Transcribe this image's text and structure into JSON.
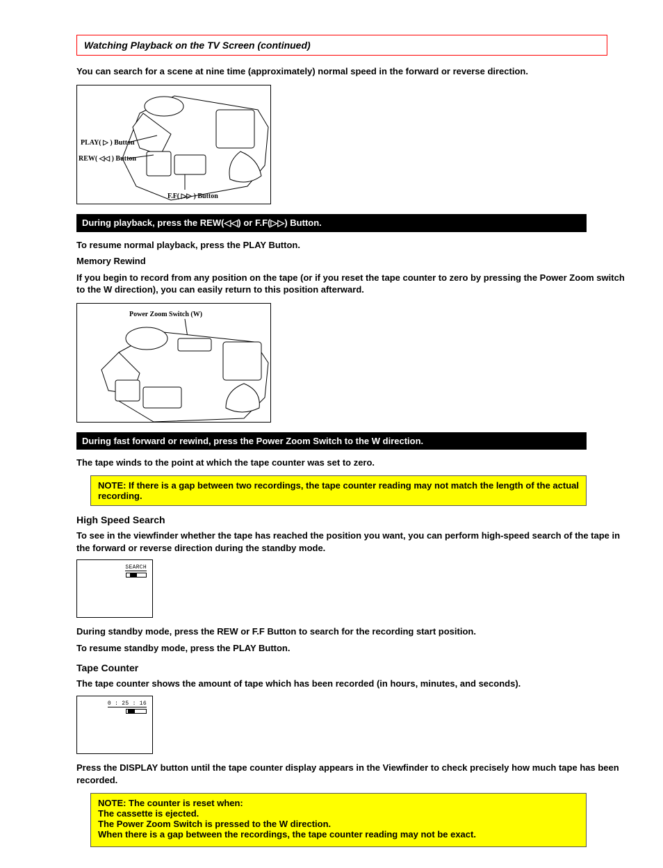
{
  "title": "Watching Playback on the TV Screen (continued)",
  "p1": "You can search for a scene at nine time (approximately) normal speed in the forward or reverse direction.",
  "fig1": {
    "play": "PLAY( ▷ ) Button",
    "rew": "REW( ◁◁ ) Button",
    "ff": "F.F( ▷▷ ) Button"
  },
  "bar1": "During playback, press the REW(◁◁) or F.F(▷▷) Button.",
  "p2": "To resume normal playback, press the PLAY Button.",
  "p3": "Memory Rewind",
  "p4": "If you begin to record from any position on the tape (or if you reset the tape counter to zero by pressing the Power Zoom switch to the W direction), you can easily return to this position afterward.",
  "fig2": {
    "pzs": "Power Zoom Switch (W)"
  },
  "bar2": "During fast forward or rewind, press the Power Zoom Switch to the W direction.",
  "p5": "The tape winds to the point at which the tape counter was set to zero.",
  "note1": "NOTE: If there is a gap between two recordings, the tape counter reading may not match the length of the actual recording.",
  "subhead1": "High Speed Search",
  "p6": "To see in the viewfinder whether the tape has reached the position you want, you can perform high-speed search of the tape in the forward or reverse direction during the standby mode.",
  "sb1_label": "SEARCH",
  "p7": "During standby mode, press the REW or F.F Button to search for the recording start position.",
  "p8": "To resume standby mode, press the PLAY Button.",
  "subhead2": "Tape Counter",
  "p9": "The tape counter shows the amount of tape which has been recorded (in hours, minutes, and seconds).",
  "sb2_label": "0 : 25 : 16",
  "p10": "Press the DISPLAY button until the tape counter display appears in the Viewfinder to check precisely how much tape has been recorded.",
  "note2": {
    "l1": "NOTE: The counter is reset when:",
    "l2": "The cassette is ejected.",
    "l3": "The Power Zoom Switch is pressed to the W direction.",
    "l4": "When there is a gap between the recordings, the tape counter reading may not be exact."
  }
}
